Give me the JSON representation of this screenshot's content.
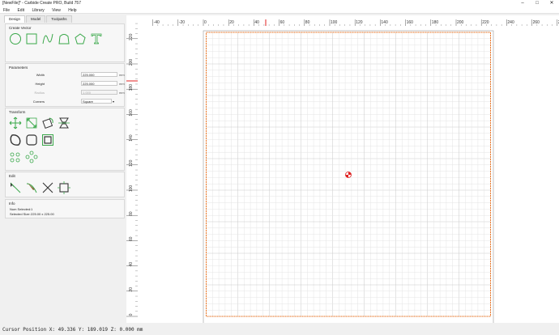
{
  "window": {
    "title": "[NewFile]* - Carbide Create PRO, Build 757",
    "minimize": "–",
    "maximize": "□",
    "close": "✕"
  },
  "menu": [
    "File",
    "Edit",
    "Library",
    "View",
    "Help"
  ],
  "tabs": [
    "Design",
    "Model",
    "Toolpaths"
  ],
  "create_vector": {
    "title": "Create Vector",
    "tools": [
      "circle-icon",
      "rectangle-icon",
      "curve-icon",
      "polyline-icon",
      "polygon-icon",
      "text-icon"
    ]
  },
  "parameters": {
    "title": "Parameters",
    "width_label": "Width",
    "width_value": "225.000",
    "height_label": "Height",
    "height_value": "225.000",
    "radius_label": "Radius",
    "radius_value": "1.000",
    "corners_label": "Corners",
    "corners_value": "Square",
    "unit": "mm"
  },
  "transform": {
    "title": "Transform",
    "tools": [
      "move-icon",
      "scale-icon",
      "rotate-icon",
      "mirror-icon",
      "offset-icon",
      "fillet-icon",
      "boolean-icon",
      "array-icon",
      "circular-array-icon"
    ]
  },
  "edit": {
    "title": "Edit",
    "tools": [
      "node-edit-icon",
      "knife-icon",
      "trim-icon",
      "join-icon"
    ]
  },
  "info": {
    "title": "Info",
    "num_selected_label": "Num Selected:",
    "num_selected": "1",
    "selected_size_label": "Selected Size:",
    "selected_size": "225.00 x 225.00"
  },
  "rulers": {
    "top_ticks": [
      "-40",
      "-20",
      "0",
      "20",
      "40",
      "60",
      "80",
      "100",
      "120",
      "140",
      "160",
      "180",
      "200",
      "220",
      "240",
      "260",
      "280"
    ],
    "left_ticks": [
      "220",
      "200",
      "180",
      "160",
      "140",
      "120",
      "100",
      "80",
      "60",
      "40",
      "20",
      "0"
    ]
  },
  "status": "Cursor Position X: 49.336 Y: 189.019 Z: 0.000 mm",
  "colors": {
    "accent_green": "#3aa84a",
    "selection_orange": "#f07a2a",
    "origin_red": "#e02020"
  }
}
